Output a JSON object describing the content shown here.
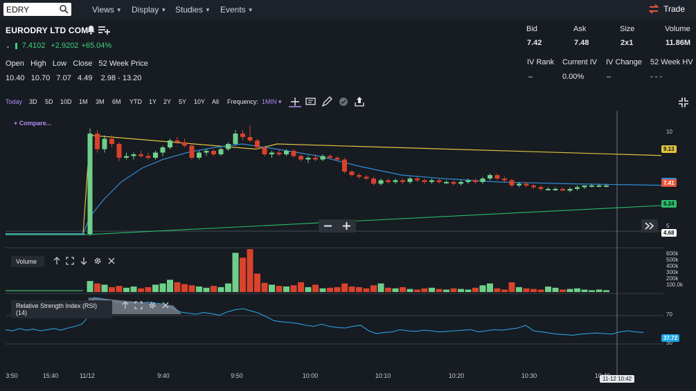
{
  "search": {
    "value": "EDRY"
  },
  "menu": {
    "views": "Views",
    "display": "Display",
    "studies": "Studies",
    "events": "Events",
    "trade": "Trade"
  },
  "symbol": {
    "name": "EURODRY LTD COM",
    "last": "7.4102",
    "change": "+2.9202",
    "change_pct": "+65.04%"
  },
  "ohlc": {
    "open_label": "Open",
    "high_label": "High",
    "low_label": "Low",
    "close_label": "Close",
    "range_label": "52 Week Price",
    "open": "10.40",
    "high": "10.70",
    "low": "7.07",
    "close": "4.49",
    "range": "2.98 - 13.20"
  },
  "quote": {
    "bid_label": "Bid",
    "ask_label": "Ask",
    "size_label": "Size",
    "volume_label": "Volume",
    "bid": "7.42",
    "ask": "7.48",
    "size": "2x1",
    "volume": "11.86M",
    "ivrank_label": "IV Rank",
    "curiv_label": "Current IV",
    "ivchg_label": "IV Change",
    "hv_label": "52 Week HV",
    "ivrank": "–",
    "curiv": "0.00%",
    "ivchg": "–",
    "hv": "- - -"
  },
  "timeframes": [
    "Today",
    "3D",
    "5D",
    "10D",
    "1M",
    "3M",
    "6M",
    "YTD",
    "1Y",
    "2Y",
    "5Y",
    "10Y",
    "All"
  ],
  "frequency": {
    "label": "Frequency:",
    "value": "1MIN"
  },
  "compare": "+ Compare...",
  "volume_panel": {
    "label": "Volume",
    "ticks": [
      "600k",
      "500k",
      "400k",
      "300k",
      "200k",
      "100.0k"
    ]
  },
  "rsi_panel": {
    "label": "Relative Strength Index (RSI) (14)",
    "ticks": [
      "70",
      "30"
    ],
    "value": "37.72"
  },
  "price_ticks": [
    "10",
    "5"
  ],
  "badges": {
    "ma_long": "9.13",
    "last": "7.41",
    "ma_slow": "6.24",
    "prev": "4.68"
  },
  "x_ticks": [
    "3:50",
    "15:40",
    "11/12",
    "9:40",
    "9:50",
    "10:00",
    "10:10",
    "10:20",
    "10:30",
    "10:40"
  ],
  "crosshair_time": "11-12 10:42",
  "colors": {
    "up": "#6fcf8a",
    "down": "#d9422b",
    "ma_yellow": "#e2c441",
    "ma_blue": "#2f8fd8",
    "ma_green": "#2bbd6a",
    "accent": "#b08cf4"
  },
  "chart_data": {
    "type": "candlestick",
    "candles": [
      {
        "t": "9:30",
        "o": 4.6,
        "h": 10.7,
        "l": 4.5,
        "c": 10.4
      },
      {
        "t": "9:31",
        "o": 10.4,
        "h": 10.6,
        "l": 9.3,
        "c": 9.5
      },
      {
        "t": "9:32",
        "o": 9.5,
        "h": 10.3,
        "l": 9.3,
        "c": 10.1
      },
      {
        "t": "9:33",
        "o": 10.1,
        "h": 10.3,
        "l": 9.6,
        "c": 9.8
      },
      {
        "t": "9:34",
        "o": 9.8,
        "h": 9.9,
        "l": 8.8,
        "c": 9.0
      },
      {
        "t": "9:35",
        "o": 9.0,
        "h": 9.3,
        "l": 8.9,
        "c": 9.1
      },
      {
        "t": "9:36",
        "o": 9.1,
        "h": 9.3,
        "l": 8.9,
        "c": 9.2
      },
      {
        "t": "9:37",
        "o": 9.2,
        "h": 9.4,
        "l": 9.0,
        "c": 9.1
      },
      {
        "t": "9:38",
        "o": 9.1,
        "h": 9.3,
        "l": 8.9,
        "c": 9.0
      },
      {
        "t": "9:39",
        "o": 9.0,
        "h": 9.4,
        "l": 8.9,
        "c": 9.3
      },
      {
        "t": "9:40",
        "o": 9.3,
        "h": 9.7,
        "l": 9.1,
        "c": 9.6
      },
      {
        "t": "9:41",
        "o": 9.6,
        "h": 10.1,
        "l": 9.5,
        "c": 10.0
      },
      {
        "t": "9:42",
        "o": 10.0,
        "h": 10.2,
        "l": 9.8,
        "c": 9.9
      },
      {
        "t": "9:43",
        "o": 9.9,
        "h": 10.1,
        "l": 9.6,
        "c": 9.7
      },
      {
        "t": "9:44",
        "o": 9.7,
        "h": 9.8,
        "l": 8.9,
        "c": 9.0
      },
      {
        "t": "9:45",
        "o": 9.0,
        "h": 9.4,
        "l": 8.9,
        "c": 9.3
      },
      {
        "t": "9:46",
        "o": 9.3,
        "h": 9.5,
        "l": 9.1,
        "c": 9.4
      },
      {
        "t": "9:47",
        "o": 9.4,
        "h": 9.5,
        "l": 9.1,
        "c": 9.2
      },
      {
        "t": "9:48",
        "o": 9.2,
        "h": 9.6,
        "l": 9.1,
        "c": 9.5
      },
      {
        "t": "9:49",
        "o": 9.5,
        "h": 9.9,
        "l": 9.4,
        "c": 9.8
      },
      {
        "t": "9:50",
        "o": 9.8,
        "h": 10.6,
        "l": 9.7,
        "c": 10.4
      },
      {
        "t": "9:51",
        "o": 10.4,
        "h": 10.6,
        "l": 10.0,
        "c": 10.2
      },
      {
        "t": "9:52",
        "o": 10.2,
        "h": 10.9,
        "l": 9.9,
        "c": 10.0
      },
      {
        "t": "9:53",
        "o": 10.0,
        "h": 10.1,
        "l": 9.5,
        "c": 9.6
      },
      {
        "t": "9:54",
        "o": 9.6,
        "h": 9.7,
        "l": 9.1,
        "c": 9.2
      },
      {
        "t": "9:55",
        "o": 9.2,
        "h": 9.4,
        "l": 9.0,
        "c": 9.3
      },
      {
        "t": "9:56",
        "o": 9.3,
        "h": 9.5,
        "l": 9.1,
        "c": 9.2
      },
      {
        "t": "9:57",
        "o": 9.2,
        "h": 9.5,
        "l": 9.1,
        "c": 9.4
      },
      {
        "t": "9:58",
        "o": 9.4,
        "h": 9.5,
        "l": 9.0,
        "c": 9.1
      },
      {
        "t": "9:59",
        "o": 9.1,
        "h": 9.2,
        "l": 8.8,
        "c": 8.9
      },
      {
        "t": "10:00",
        "o": 8.9,
        "h": 9.1,
        "l": 8.7,
        "c": 9.0
      },
      {
        "t": "10:01",
        "o": 9.0,
        "h": 9.2,
        "l": 8.8,
        "c": 8.9
      },
      {
        "t": "10:02",
        "o": 8.9,
        "h": 9.2,
        "l": 8.8,
        "c": 9.1
      },
      {
        "t": "10:03",
        "o": 9.1,
        "h": 9.2,
        "l": 8.9,
        "c": 9.0
      },
      {
        "t": "10:04",
        "o": 9.0,
        "h": 9.1,
        "l": 8.8,
        "c": 8.9
      },
      {
        "t": "10:05",
        "o": 8.9,
        "h": 9.0,
        "l": 8.1,
        "c": 8.2
      },
      {
        "t": "10:06",
        "o": 8.2,
        "h": 8.3,
        "l": 7.9,
        "c": 8.0
      },
      {
        "t": "10:07",
        "o": 8.0,
        "h": 8.1,
        "l": 7.8,
        "c": 7.9
      },
      {
        "t": "10:08",
        "o": 7.9,
        "h": 8.0,
        "l": 7.7,
        "c": 7.8
      },
      {
        "t": "10:09",
        "o": 7.8,
        "h": 7.9,
        "l": 7.4,
        "c": 7.5
      },
      {
        "t": "10:10",
        "o": 7.5,
        "h": 7.8,
        "l": 7.4,
        "c": 7.7
      },
      {
        "t": "10:11",
        "o": 7.7,
        "h": 7.8,
        "l": 7.5,
        "c": 7.6
      },
      {
        "t": "10:12",
        "o": 7.6,
        "h": 7.8,
        "l": 7.5,
        "c": 7.7
      },
      {
        "t": "10:13",
        "o": 7.7,
        "h": 7.8,
        "l": 7.5,
        "c": 7.6
      },
      {
        "t": "10:14",
        "o": 7.6,
        "h": 7.9,
        "l": 7.5,
        "c": 7.8
      },
      {
        "t": "10:15",
        "o": 7.8,
        "h": 7.9,
        "l": 7.6,
        "c": 7.7
      },
      {
        "t": "10:16",
        "o": 7.7,
        "h": 7.8,
        "l": 7.5,
        "c": 7.6
      },
      {
        "t": "10:17",
        "o": 7.6,
        "h": 7.8,
        "l": 7.5,
        "c": 7.7
      },
      {
        "t": "10:18",
        "o": 7.7,
        "h": 7.8,
        "l": 7.5,
        "c": 7.6
      },
      {
        "t": "10:19",
        "o": 7.6,
        "h": 7.7,
        "l": 7.5,
        "c": 7.6
      },
      {
        "t": "10:20",
        "o": 7.6,
        "h": 7.7,
        "l": 7.4,
        "c": 7.5
      },
      {
        "t": "10:21",
        "o": 7.5,
        "h": 7.7,
        "l": 7.4,
        "c": 7.6
      },
      {
        "t": "10:22",
        "o": 7.6,
        "h": 7.8,
        "l": 7.5,
        "c": 7.7
      },
      {
        "t": "10:23",
        "o": 7.7,
        "h": 7.8,
        "l": 7.5,
        "c": 7.6
      },
      {
        "t": "10:24",
        "o": 7.6,
        "h": 7.9,
        "l": 7.5,
        "c": 7.8
      },
      {
        "t": "10:25",
        "o": 7.8,
        "h": 8.1,
        "l": 7.7,
        "c": 8.0
      },
      {
        "t": "10:26",
        "o": 8.0,
        "h": 8.1,
        "l": 7.7,
        "c": 7.8
      },
      {
        "t": "10:27",
        "o": 7.8,
        "h": 7.9,
        "l": 7.6,
        "c": 7.7
      },
      {
        "t": "10:28",
        "o": 7.7,
        "h": 7.8,
        "l": 7.3,
        "c": 7.4
      },
      {
        "t": "10:29",
        "o": 7.4,
        "h": 7.6,
        "l": 7.3,
        "c": 7.5
      },
      {
        "t": "10:30",
        "o": 7.5,
        "h": 7.6,
        "l": 7.3,
        "c": 7.4
      },
      {
        "t": "10:31",
        "o": 7.4,
        "h": 7.5,
        "l": 7.2,
        "c": 7.3
      },
      {
        "t": "10:32",
        "o": 7.3,
        "h": 7.4,
        "l": 7.1,
        "c": 7.2
      },
      {
        "t": "10:33",
        "o": 7.2,
        "h": 7.3,
        "l": 7.1,
        "c": 7.2
      },
      {
        "t": "10:34",
        "o": 7.2,
        "h": 7.3,
        "l": 7.1,
        "c": 7.2
      },
      {
        "t": "10:35",
        "o": 7.2,
        "h": 7.3,
        "l": 7.1,
        "c": 7.1
      },
      {
        "t": "10:36",
        "o": 7.1,
        "h": 7.3,
        "l": 7.0,
        "c": 7.2
      },
      {
        "t": "10:37",
        "o": 7.2,
        "h": 7.4,
        "l": 7.1,
        "c": 7.3
      },
      {
        "t": "10:38",
        "o": 7.3,
        "h": 7.4,
        "l": 7.2,
        "c": 7.4
      },
      {
        "t": "10:39",
        "o": 7.4,
        "h": 7.5,
        "l": 7.3,
        "c": 7.4
      },
      {
        "t": "10:40",
        "o": 7.4,
        "h": 7.5,
        "l": 7.3,
        "c": 7.4
      },
      {
        "t": "10:41",
        "o": 7.4,
        "h": 7.5,
        "l": 7.3,
        "c": 7.4
      }
    ],
    "pre_market": {
      "from": "15:40",
      "value": 4.6
    },
    "ma_yellow_end": 9.13,
    "ma_blue_end": 7.41,
    "ma_green_start": 4.68,
    "ma_green_end": 6.24,
    "volume_k": [
      180,
      140,
      120,
      80,
      100,
      70,
      90,
      60,
      80,
      120,
      140,
      200,
      160,
      130,
      110,
      90,
      70,
      100,
      80,
      140,
      640,
      560,
      700,
      300,
      150,
      120,
      100,
      90,
      110,
      160,
      80,
      120,
      60,
      70,
      80,
      140,
      90,
      80,
      60,
      110,
      140,
      70,
      60,
      80,
      50,
      40,
      60,
      70,
      50,
      40,
      60,
      50,
      40,
      70,
      110,
      140,
      60,
      40,
      160,
      80,
      60,
      50,
      40,
      90,
      70,
      40,
      50,
      60,
      40,
      30,
      40,
      30
    ],
    "rsi": [
      60,
      100,
      98,
      95,
      92,
      90,
      91,
      90,
      92,
      90,
      88,
      82,
      74,
      72,
      70,
      73,
      71,
      68,
      74,
      78,
      80,
      76,
      72,
      65,
      58,
      56,
      55,
      53,
      50,
      48,
      52,
      48,
      46,
      45,
      48,
      50,
      40,
      35,
      37,
      38,
      42,
      40,
      39,
      41,
      40,
      38,
      39,
      40,
      41,
      42,
      38,
      40,
      42,
      41,
      43,
      45,
      50,
      40,
      38,
      36,
      34,
      33,
      32,
      34,
      35,
      36,
      35,
      34,
      38,
      40,
      38,
      37
    ],
    "ylim": [
      4,
      11
    ]
  }
}
